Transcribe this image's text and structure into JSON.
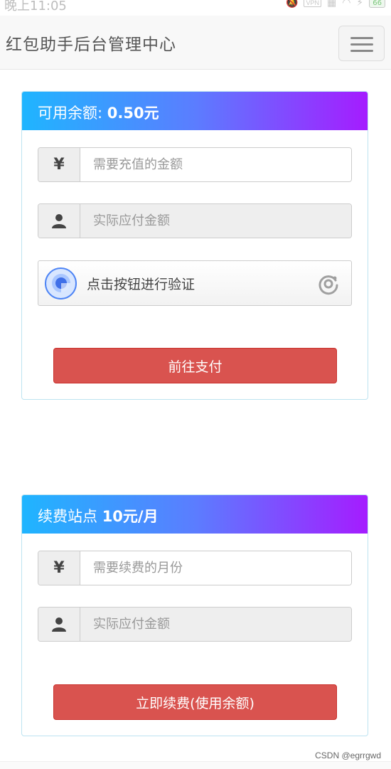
{
  "status_bar": {
    "time": "晚上11:05",
    "vpn": "VPN",
    "battery": "66"
  },
  "navbar": {
    "brand": "红包助手后台管理中心"
  },
  "recharge_panel": {
    "title_label": "可用余额: ",
    "title_amount": "0.50元",
    "currency_symbol": "¥",
    "amount_placeholder": "需要充值的金额",
    "actual_placeholder": "实际应付金额",
    "captcha_text": "点击按钮进行验证",
    "pay_button": "前往支付"
  },
  "renew_panel": {
    "title_label": "续费站点 ",
    "title_amount": "10元/月",
    "currency_symbol": "¥",
    "months_placeholder": "需要续费的月份",
    "actual_placeholder": "实际应付金额",
    "renew_button": "立即续费(使用余额)"
  },
  "watermark": "CSDN @egrrgwd",
  "colors": {
    "gradient_start": "#1fb5ff",
    "gradient_end": "#a51cff",
    "button": "#d9534f",
    "captcha_accent": "#4d84f5"
  }
}
